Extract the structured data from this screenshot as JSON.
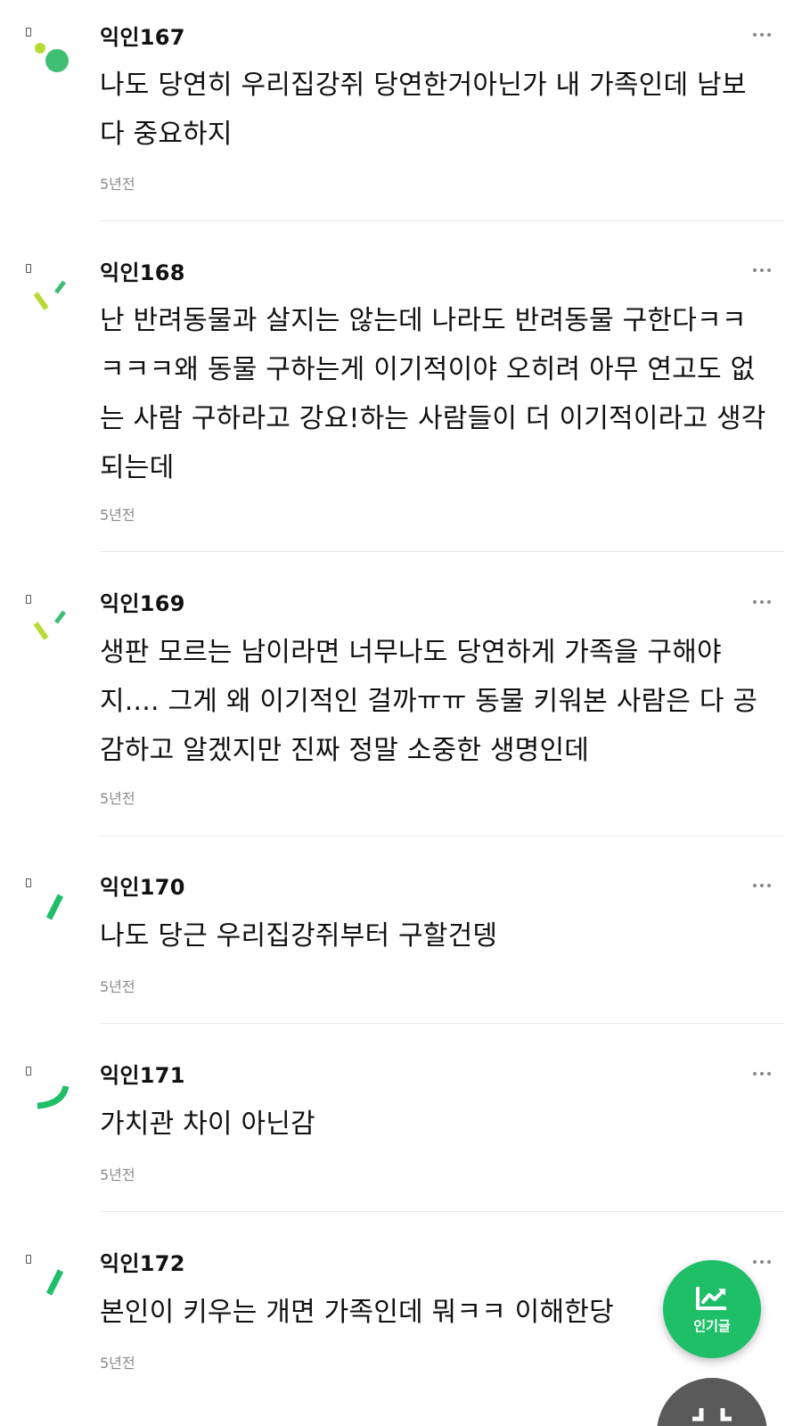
{
  "comments": [
    {
      "nickname": "익인167",
      "text": "나도 당연히 우리집강쥐 당연한거아닌가 내 가족인데 남보다 중요하지",
      "lines": [
        "나도 당연히 우리집강쥐 당연한거아닌가 내 가족인데 남보",
        "다 중요하지"
      ],
      "time": "5년전",
      "avatar": "dots-avatar-icon"
    },
    {
      "nickname": "익인168",
      "text": "난 반려동물과 살지는 않는데 나라도 반려동물 구한다ㅋㅋㅋㅋㅋ왜 동물 구하는게 이기적이야 오히려 아무 연고도 없는 사람 구하라고 강요!하는 사람들이 더 이기적이라고 생각되는데",
      "lines": [
        "난 반려동물과 살지는 않는데 나라도 반려동물 구한다ㅋㅋ",
        "ㅋㅋㅋ왜 동물 구하는게 이기적이야 오히려 아무 연고도 없",
        "는 사람 구하라고 강요!하는 사람들이 더 이기적이라고 생각",
        "되는데"
      ],
      "time": "5년전",
      "avatar": "dashes-avatar-icon"
    },
    {
      "nickname": "익인169",
      "text": "생판 모르는 남이라면 너무나도 당연하게 가족을 구해야지.... 그게 왜 이기적인 걸까ㅠㅠ 동물 키워본 사람은 다 공감하고 알겠지만 진짜 정말 소중한 생명인데",
      "lines": [
        "생판 모르는 남이라면 너무나도 당연하게 가족을 구해야",
        "지.... 그게 왜 이기적인 걸까ㅠㅠ 동물 키워본 사람은 다 공",
        "감하고 알겠지만 진짜 정말 소중한 생명인데"
      ],
      "time": "5년전",
      "avatar": "dashes-avatar-icon"
    },
    {
      "nickname": "익인170",
      "text": "나도 당근 우리집강쥐부터 구할건뎅",
      "lines": [
        "나도 당근 우리집강쥐부터 구할건뎅"
      ],
      "time": "5년전",
      "avatar": "slash-avatar-icon"
    },
    {
      "nickname": "익인171",
      "text": "가치관 차이 아닌감",
      "lines": [
        "가치관 차이 아닌감"
      ],
      "time": "5년전",
      "avatar": "arc-avatar-icon"
    },
    {
      "nickname": "익인172",
      "text": "본인이 키우는 개면 가족인데 뭐ㅋㅋ 이해한당",
      "lines": [
        "본인이 키우는 개면 가족인데 뭐ㅋㅋ 이해한당"
      ],
      "time": "5년전",
      "avatar": "slash-avatar-icon"
    }
  ],
  "fab": {
    "popular_label": "인기글",
    "popular_icon": "trending-chart-icon",
    "second_icon": "collapse-icon"
  },
  "colors": {
    "accent_green": "#1fbf68",
    "lime": "#b8d934",
    "text": "#111111",
    "meta": "#8a8a8a"
  }
}
